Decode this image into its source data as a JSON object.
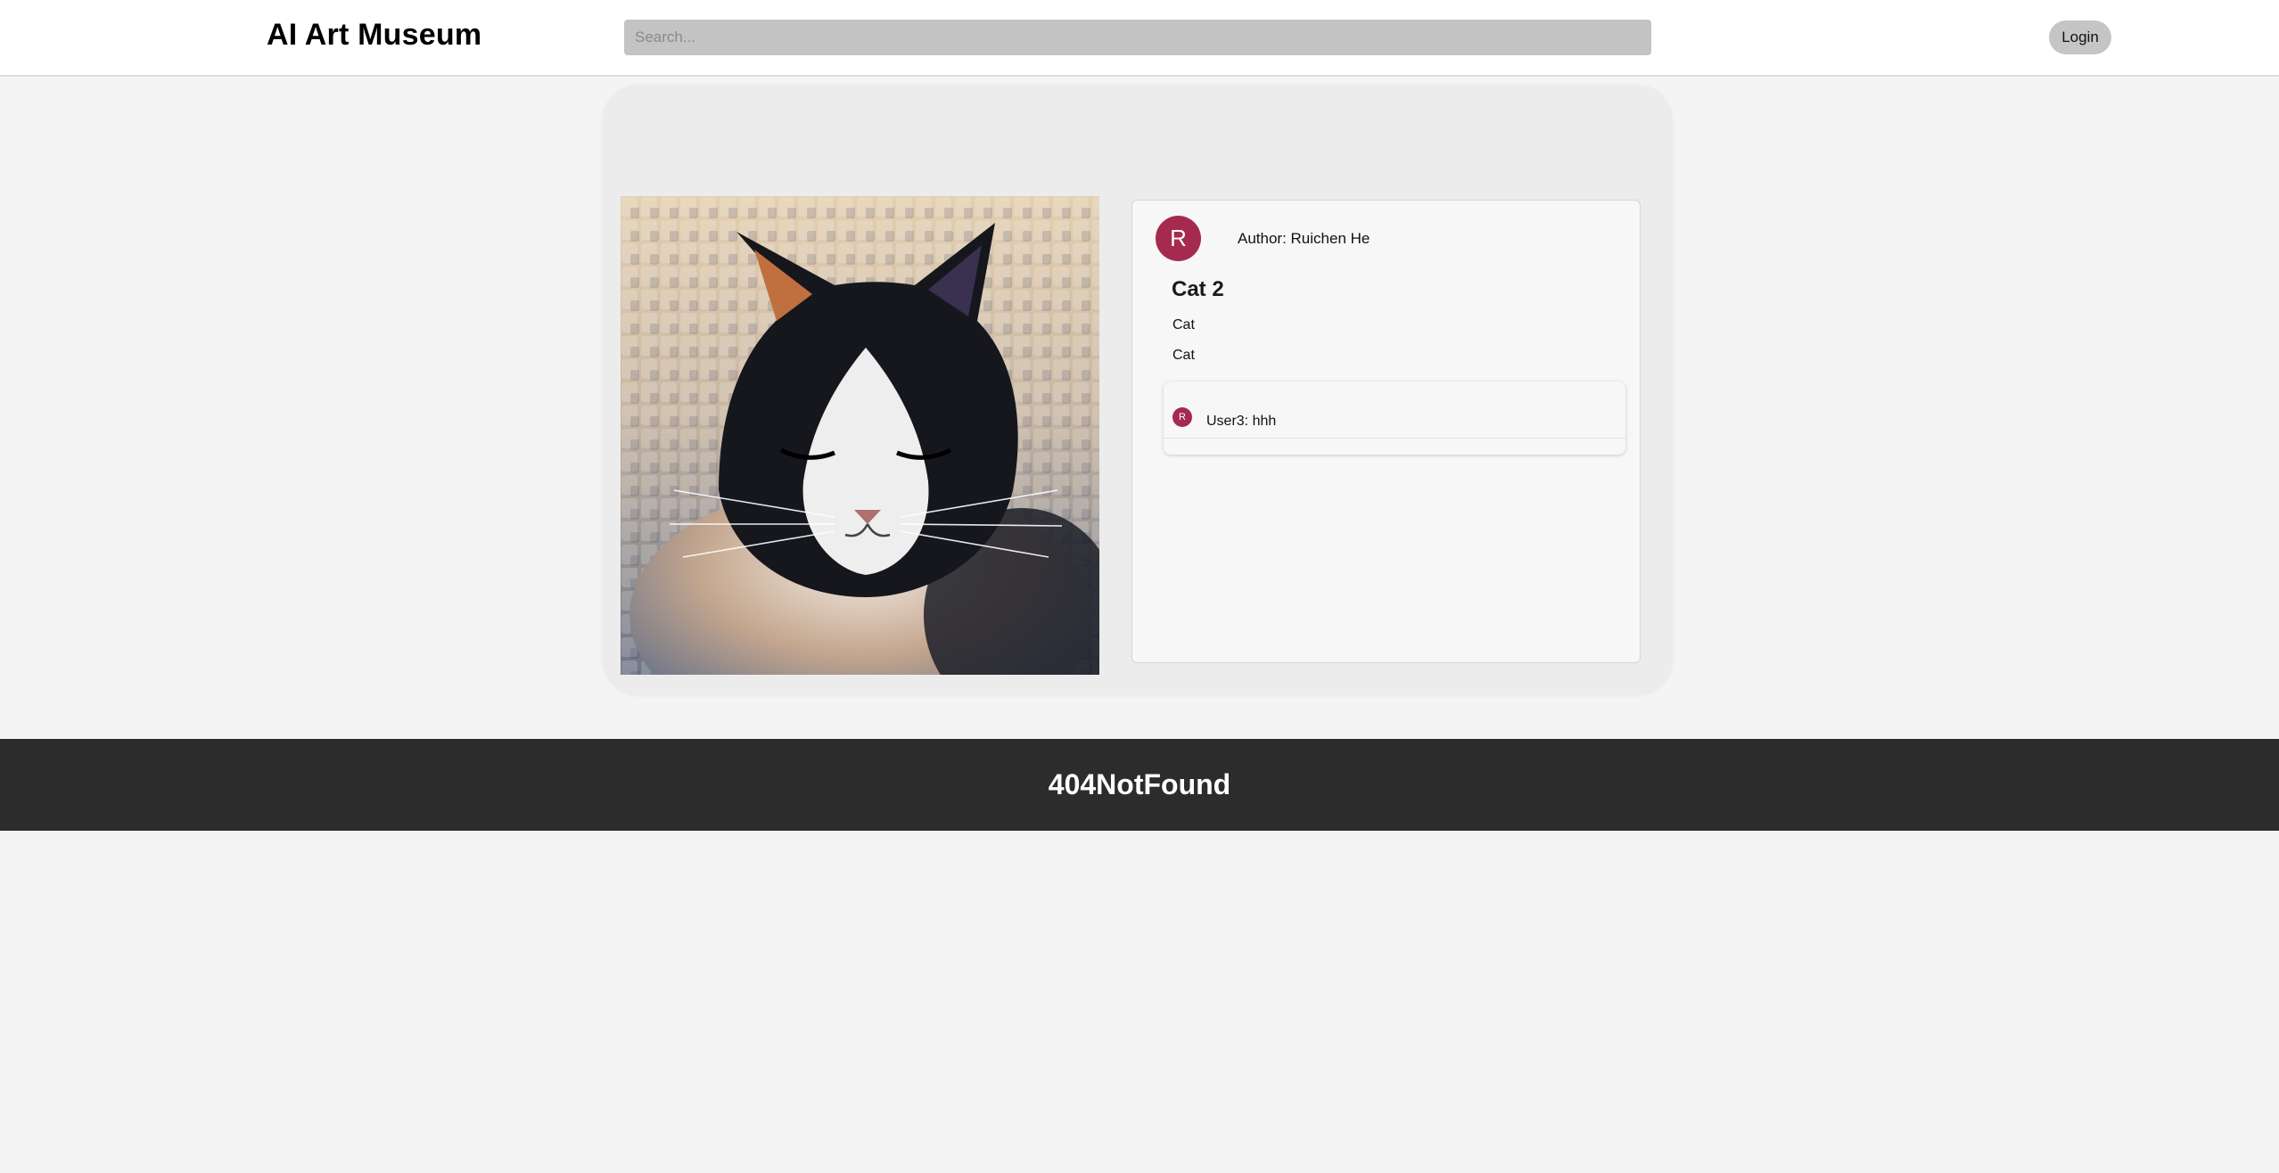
{
  "header": {
    "brand": "AI Art Museum",
    "search_placeholder": "Search...",
    "login_label": "Login"
  },
  "artwork": {
    "author_initial": "R",
    "author_line": "Author: Ruichen He",
    "title": "Cat 2",
    "tag": "Cat",
    "description": "Cat",
    "image_subject": "cat-painting"
  },
  "comments": [
    {
      "avatar_initial": "R",
      "text": "User3: hhh"
    }
  ],
  "footer": {
    "title": "404NotFound"
  },
  "colors": {
    "avatar": "#a52a50",
    "footer_bg": "#2c2c2c",
    "search_bg": "#c3c3c3",
    "login_bg": "#c5c5c5"
  }
}
